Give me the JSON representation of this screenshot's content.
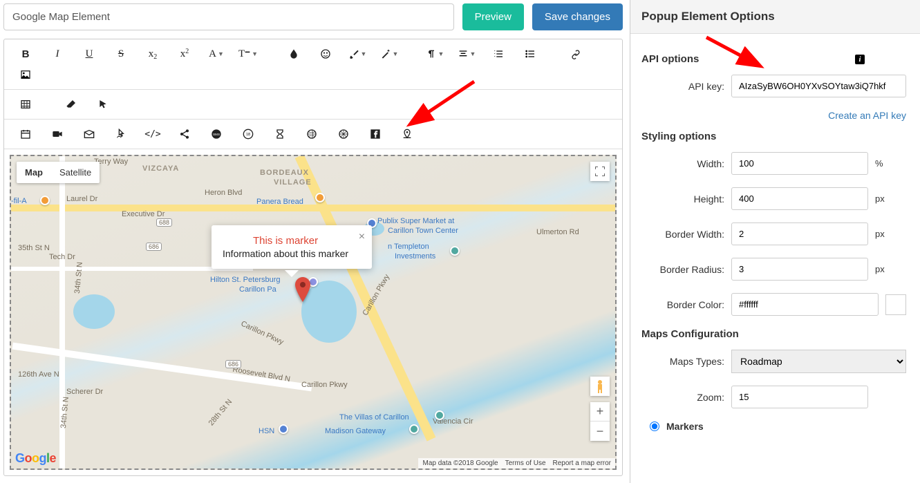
{
  "header": {
    "title_value": "Google Map Element",
    "preview": "Preview",
    "save": "Save changes"
  },
  "toolbar_icons": {
    "bold": "B",
    "italic": "I",
    "underline": "U",
    "strike": "S",
    "sub": "x",
    "sub2": "2",
    "sup": "x",
    "sup2": "2",
    "font": "A",
    "tt": "T",
    "ol": "≡",
    "ul": "≡"
  },
  "map": {
    "tab_map": "Map",
    "tab_sat": "Satellite",
    "info_title": "This is marker",
    "info_body": "Information about this marker",
    "footer_data": "Map data ©2018 Google",
    "footer_terms": "Terms of Use",
    "footer_report": "Report a map error",
    "logo_g": "G",
    "logo_o1": "o",
    "logo_o2": "o",
    "logo_g2": "g",
    "logo_l": "l",
    "logo_e": "e",
    "labels": {
      "vizcaya": "VIZCAYA",
      "bordeaux": "BORDEAUX",
      "village": "VILLAGE",
      "filA": "-fil-A",
      "panera": "Panera Bread",
      "publix": "Publix Super Market at",
      "carillon_tc": "Carillon Town Center",
      "templeton": "n Templeton",
      "investments": "Investments",
      "hilton": "Hilton St. Petersburg",
      "carillon_p": "Carillon Pa",
      "villas": "The Villas of Carillon",
      "madison": "Madison Gateway",
      "hsn": "HSN",
      "terry": "Terry Way",
      "laurel": "Laurel Dr",
      "executive": "Executive Dr",
      "heroin": "Heron Blvd",
      "ulmerton": "Ulmerton Rd",
      "tech": "Tech Dr",
      "126th": "126th Ave N",
      "scherer": "Scherer Dr",
      "34th_s": "34th St N",
      "34th_s2": "34th St N",
      "35th": "35th St N",
      "28th": "28th St N",
      "roosevelt": "Roosevelt Blvd N",
      "carillon_pk": "Carillon Pkwy",
      "carillon_pk2": "Carillon Pkwy",
      "valencia": "Valencia Cir",
      "688": "688",
      "686": "686",
      "686b": "686"
    }
  },
  "panel": {
    "title": "Popup Element Options",
    "api_section": "API options",
    "api_key_label": "API key:",
    "api_key_value": "AIzaSyBW6OH0YXvSOYtaw3iQ7hkf",
    "create_link": "Create an API key",
    "styling_section": "Styling options",
    "width_label": "Width:",
    "width_value": "100",
    "width_unit": "%",
    "height_label": "Height:",
    "height_value": "400",
    "height_unit": "px",
    "bwidth_label": "Border Width:",
    "bwidth_value": "2",
    "bwidth_unit": "px",
    "bradius_label": "Border Radius:",
    "bradius_value": "3",
    "bradius_unit": "px",
    "bcolor_label": "Border Color:",
    "bcolor_value": "#ffffff",
    "maps_section": "Maps Configuration",
    "types_label": "Maps Types:",
    "types_value": "Roadmap",
    "zoom_label": "Zoom:",
    "zoom_value": "15",
    "markers_label": "Markers"
  }
}
